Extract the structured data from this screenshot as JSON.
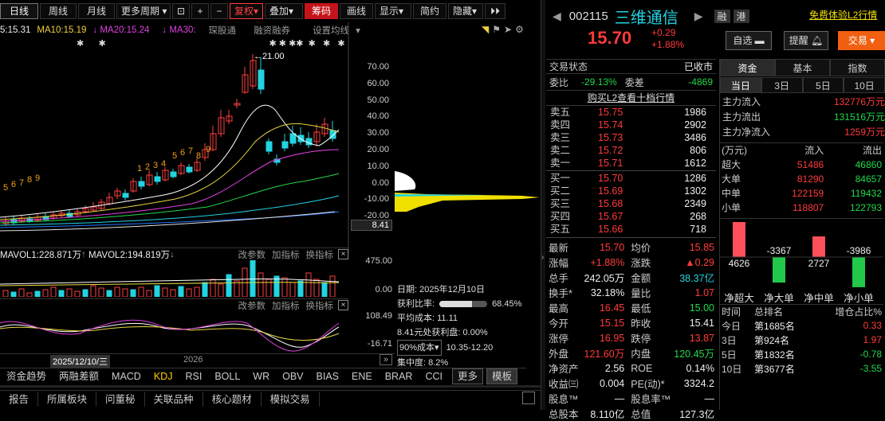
{
  "toolbar": {
    "daily": "日线",
    "weekly": "周线",
    "monthly": "月线",
    "more_periods": "更多周期",
    "fq": "复权",
    "overlay": "叠加",
    "chips": "筹码",
    "draw": "画线",
    "display": "显示",
    "simple": "简约",
    "hide": "隐藏"
  },
  "ma": {
    "ma5": "5:15.31",
    "ma10": "MA10:15.19",
    "ma20": "MA20:15.24",
    "ma30": "MA30:",
    "tip": "琛股通",
    "margin": "融资融券",
    "settings": "设置均线"
  },
  "price_axis": [
    "70.00",
    "60.00",
    "50.00",
    "40.00",
    "30.00",
    "20.00",
    "10.00",
    "0.00",
    "-10.00",
    "-20.00"
  ],
  "price_marker": "8.41",
  "peak_label": "←21.00",
  "candle_counts": [
    "5",
    "6",
    "7",
    "8",
    "9",
    "1",
    "2",
    "3",
    "4",
    "5",
    "6",
    "7",
    "8",
    "9"
  ],
  "vol": {
    "mavol1": "MAVOL1:228.871万",
    "mavol2": "MAVOL2:194.819万",
    "edit": "改参数",
    "add": "加指标",
    "swap": "换指标",
    "axis_top": "475.00",
    "axis_bottom": "0.00"
  },
  "kdj": {
    "edit": "改参数",
    "add": "加指标",
    "swap": "换指标",
    "axis_top": "108.49",
    "axis_bottom": "-16.71"
  },
  "dates": {
    "d1": "2025/12/10/三",
    "d2": "2026"
  },
  "chip_info": {
    "date": "日期: 2025年12月10日",
    "profit_label": "获利比率:",
    "profit_pct": "68.45%",
    "profit_fill": 0.6845,
    "avg_cost": "平均成本: 11.11",
    "at_price": "8.41元处获利盘: 0.00%",
    "cost_select": "90%成本",
    "cost_range": "10.35-12.20",
    "concentration": "集中度: 8.2%"
  },
  "indicator_tabs": [
    "资金趋势",
    "两融差额",
    "MACD",
    "KDJ",
    "RSI",
    "BOLL",
    "WR",
    "OBV",
    "BIAS",
    "ENE",
    "BRAR",
    "CCI",
    "更多",
    "模板"
  ],
  "bottom_tabs": [
    "报告",
    "所属板块",
    "问董秘",
    "关联品种",
    "核心题材",
    "模拟交易"
  ],
  "stock": {
    "code": "002115",
    "name": "三维通信",
    "price": "15.70",
    "change": "+0.29",
    "change_pct": "+1.88%",
    "badge1": "融",
    "badge2": "港",
    "l2_link": "免费体验L2行情",
    "watch": "自选",
    "remind": "提醒",
    "trade": "交易"
  },
  "status": {
    "label": "交易状态",
    "value": "已收市",
    "wb_label": "委比",
    "wb": "-29.13%",
    "wc_label": "委差",
    "wc": "-4869",
    "l2_link": "购买L2查看十档行情"
  },
  "sells": [
    {
      "l": "卖五",
      "p": "15.75",
      "v": "1986"
    },
    {
      "l": "卖四",
      "p": "15.74",
      "v": "2902"
    },
    {
      "l": "卖三",
      "p": "15.73",
      "v": "3486"
    },
    {
      "l": "卖二",
      "p": "15.72",
      "v": "806"
    },
    {
      "l": "卖一",
      "p": "15.71",
      "v": "1612"
    }
  ],
  "buys": [
    {
      "l": "买一",
      "p": "15.70",
      "v": "1286"
    },
    {
      "l": "买二",
      "p": "15.69",
      "v": "1302"
    },
    {
      "l": "买三",
      "p": "15.68",
      "v": "2349"
    },
    {
      "l": "买四",
      "p": "15.67",
      "v": "268"
    },
    {
      "l": "买五",
      "p": "15.66",
      "v": "718"
    }
  ],
  "stats": [
    [
      "最新",
      "15.70",
      "均价",
      "15.85"
    ],
    [
      "涨幅",
      "+1.88%",
      "涨跌",
      "▲0.29"
    ],
    [
      "总手",
      "242.05万",
      "金额",
      "38.37亿"
    ],
    [
      "换手*",
      "32.18%",
      "量比",
      "1.07"
    ],
    [
      "最高",
      "16.45",
      "最低",
      "15.00"
    ],
    [
      "今开",
      "15.15",
      "昨收",
      "15.41"
    ],
    [
      "涨停",
      "16.95",
      "跌停",
      "13.87"
    ],
    [
      "外盘",
      "121.60万",
      "内盘",
      "120.45万"
    ],
    [
      "净资产",
      "2.56",
      "ROE",
      "0.14%"
    ],
    [
      "收益㈢",
      "0.004",
      "PE(动)*",
      "3324.2"
    ],
    [
      "股息™",
      "—",
      "股息率™",
      "—"
    ],
    [
      "总股本",
      "8.110亿",
      "总值",
      "127.3亿"
    ]
  ],
  "fund": {
    "tabs": [
      "资金",
      "基本",
      "指数"
    ],
    "periods": [
      "当日",
      "3日",
      "5日",
      "10日"
    ],
    "inflow_label": "主力流入",
    "inflow": "132776万元",
    "outflow_label": "主力流出",
    "outflow": "131516万元",
    "net_label": "主力净流入",
    "net": "1259万元",
    "head": [
      "(万元)",
      "流入",
      "流出"
    ],
    "rows": [
      [
        "超大",
        "51486",
        "46860"
      ],
      [
        "大单",
        "81290",
        "84657"
      ],
      [
        "中单",
        "122159",
        "119432"
      ],
      [
        "小单",
        "118807",
        "122793"
      ]
    ],
    "bars": [
      {
        "label": "净超大",
        "value": "4626"
      },
      {
        "label": "净大单",
        "value": "-3367"
      },
      {
        "label": "净中单",
        "value": "2727"
      },
      {
        "label": "净小单",
        "value": "-3986"
      }
    ],
    "rank_head": [
      "时间",
      "总排名",
      "增仓占比%"
    ],
    "ranks": [
      [
        "今日",
        "第1685名",
        "0.33"
      ],
      [
        "3日",
        "第924名",
        "1.97"
      ],
      [
        "5日",
        "第1832名",
        "-0.78"
      ],
      [
        "10日",
        "第3677名",
        "-3.55"
      ]
    ]
  }
}
